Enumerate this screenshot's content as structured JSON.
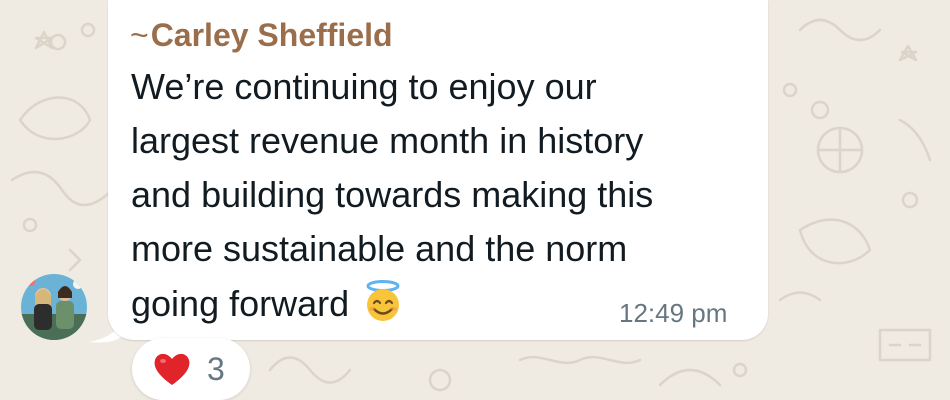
{
  "chat": {
    "message": {
      "sender_prefix": "~",
      "sender_name": "Carley Sheffield",
      "lines": [
        "We’re continuing to enjoy our",
        "largest revenue month in history",
        "and building towards making this",
        "more sustainable and the norm",
        "going forward"
      ],
      "emoji": "smiling-face-with-halo",
      "time": "12:49 pm"
    },
    "reaction": {
      "emoji": "red-heart",
      "count": "3"
    }
  },
  "colors": {
    "wallpaper": "#efeae2",
    "bubble": "#ffffff",
    "sender": "#9a6d4b",
    "text": "#111b21",
    "timestamp": "#667781",
    "heart": "#e0242a"
  }
}
